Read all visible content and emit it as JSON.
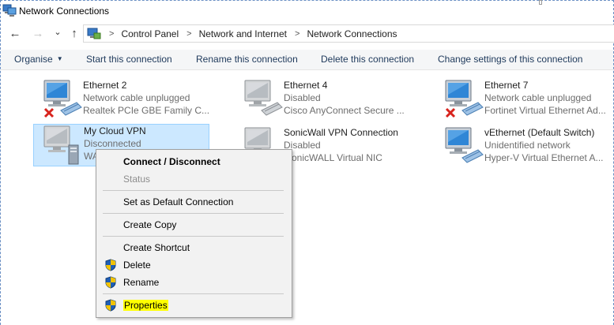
{
  "window": {
    "title": "Network Connections"
  },
  "address": {
    "crumbs": [
      "Control Panel",
      "Network and Internet",
      "Network Connections"
    ],
    "sep": ">"
  },
  "nav": {
    "back": "←",
    "forward": "→",
    "dropdown": "⌄",
    "up": "↑"
  },
  "toolbar": {
    "organise": "Organise",
    "caret": "▼",
    "start": "Start this connection",
    "rename": "Rename this connection",
    "delete": "Delete this connection",
    "change": "Change settings of this connection"
  },
  "connections": [
    {
      "name": "Ethernet 2",
      "status": "Network cable unplugged",
      "device": "Realtek PCIe GBE Family C...",
      "icon": "ethernet-unplugged-icon"
    },
    {
      "name": "Ethernet 4",
      "status": "Disabled",
      "device": "Cisco AnyConnect Secure ...",
      "icon": "ethernet-disabled-icon"
    },
    {
      "name": "Ethernet 7",
      "status": "Network cable unplugged",
      "device": "Fortinet Virtual Ethernet Ad...",
      "icon": "ethernet-unplugged-icon"
    },
    {
      "name": "My Cloud VPN",
      "status": "Disconnected",
      "device": "WA",
      "icon": "vpn-connection-icon"
    },
    {
      "name": "SonicWall VPN Connection",
      "status": "Disabled",
      "device": "onicWALL Virtual NIC",
      "icon": "ethernet-disabled-icon"
    },
    {
      "name": "vEthernet (Default Switch)",
      "status": "Unidentified network",
      "device": "Hyper-V Virtual Ethernet A...",
      "icon": "ethernet-connected-icon"
    }
  ],
  "context_menu": {
    "connect": "Connect / Disconnect",
    "status": "Status",
    "set_default": "Set as Default Connection",
    "create_copy": "Create Copy",
    "create_shortcut": "Create Shortcut",
    "delete": "Delete",
    "rename": "Rename",
    "properties": "Properties"
  },
  "colors": {
    "selection": "#cce8ff",
    "toolbar_text": "#1e395b",
    "highlight": "#ffff00",
    "unplugged_x": "#d8231d"
  }
}
